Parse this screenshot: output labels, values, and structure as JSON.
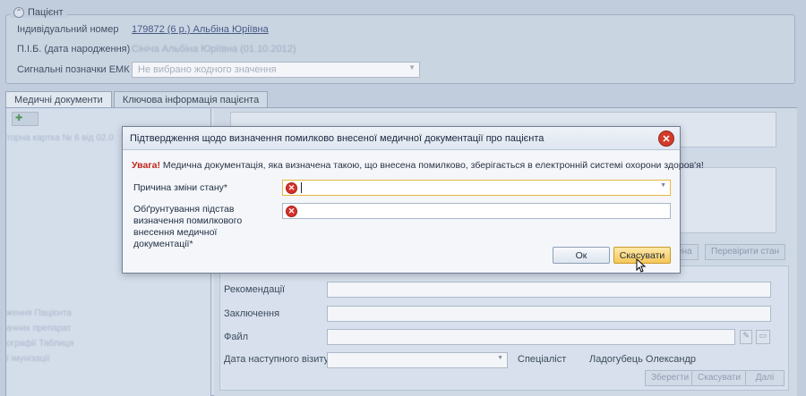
{
  "patient": {
    "group_title": "Пацієнт",
    "id_label": "Індивідуальний номер",
    "id_value": "179872 (6 р.) Альбіна Юріївна",
    "name_label": "П.І.Б. (дата народження)",
    "name_value": "Сініча Альбіна Юріївна (01.10.2012)",
    "signals_label": "Сигнальні позначки ЕМК",
    "signals_placeholder": "Не вибрано жодного значення"
  },
  "tabs": [
    {
      "label": "Медичні документи"
    },
    {
      "label": "Ключова інформація пацієнта"
    }
  ],
  "left_panel": {
    "items": [
      "торна картка № 6 від 02.0",
      "ження Пацієнта",
      "ачних препарат",
      "ографії Таблиця",
      "ї імунізації"
    ]
  },
  "background_buttons": {
    "partial": "ена",
    "check_status": "Перевірити стан"
  },
  "form": {
    "recommendations_label": "Рекомендації",
    "conclusion_label": "Заключення",
    "file_label": "Файл",
    "next_visit_label": "Дата наступного візиту",
    "specialist_label": "Спеціаліст",
    "specialist_value": "Ладогубець Олександр",
    "save": "Зберегти",
    "cancel": "Скасувати",
    "next": "Далі"
  },
  "dialog": {
    "title": "Підтвердження щодо визначення помилково внесеної медичної документації про пацієнта",
    "warning_prefix": "Увага!",
    "warning_text": " Медична документація, яка визначена такою, що внесена помилково, зберігається в електронній системі охорони здоров'я!",
    "reason_label": "Причина зміни стану*",
    "justification_label": "Обґрунтування підстав визначення помилкового внесення медичної документації*",
    "ok": "Ок",
    "cancel": "Скасувати"
  }
}
